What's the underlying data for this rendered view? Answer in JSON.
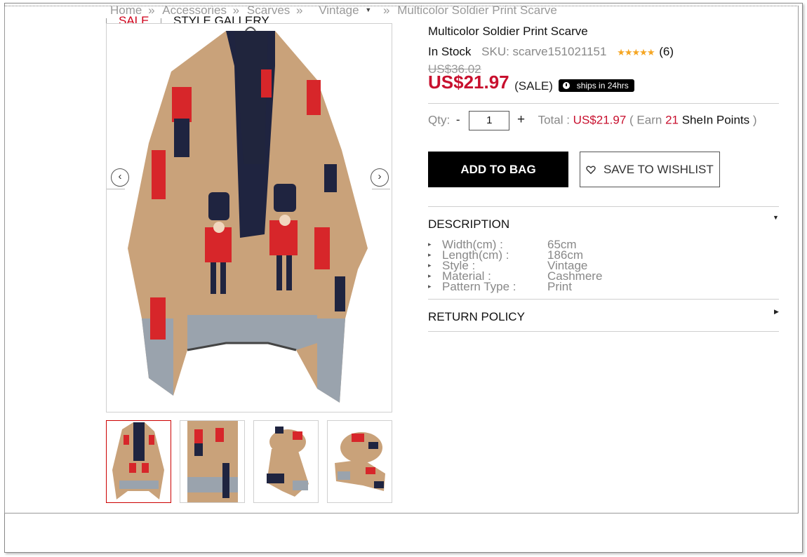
{
  "breadcrumb": {
    "home": "Home",
    "sep": "»",
    "accessories": "Accessories",
    "scarves": "Scarves",
    "vintage": "Vintage",
    "current": "Multicolor Soldier Print Scarve"
  },
  "gallery": {
    "tab_sale": "SALE",
    "tab_style": "STYLE GALLERY",
    "prev_arrow": "‹",
    "next_arrow": "›"
  },
  "product": {
    "title": "Multicolor Soldier Print Scarve",
    "stock": "In Stock",
    "sku": "SKU: scarve151021151",
    "rating_stars": "★★★★★",
    "review_count": "(6)",
    "original_price": "US$36.02",
    "sale_price": "US$21.97",
    "sale_tag": "(SALE)",
    "ship_badge": "ships in 24hrs"
  },
  "purchase": {
    "qty_label": "Qty:",
    "minus": "-",
    "qty_value": "1",
    "plus": "+",
    "total_label": "Total :",
    "total_value": "US$21.97",
    "earn_open": "( Earn",
    "points": "21",
    "shein_points": "SheIn Points",
    "earn_close": ")",
    "add_to_bag": "ADD TO BAG",
    "save_wishlist": "SAVE TO WISHLIST"
  },
  "description": {
    "title": "DESCRIPTION",
    "items": [
      {
        "key": "Width(cm) :",
        "value": "65cm"
      },
      {
        "key": "Length(cm) :",
        "value": "186cm"
      },
      {
        "key": "Style :",
        "value": "Vintage"
      },
      {
        "key": "Material :",
        "value": "Cashmere"
      },
      {
        "key": "Pattern Type :",
        "value": "Print"
      }
    ]
  },
  "return_policy": {
    "title": "RETURN POLICY"
  },
  "colors": {
    "sale_red": "#c8102e",
    "star_gold": "#f5a623",
    "scarf_tan": "#c9a27a",
    "soldier_red": "#d7262a",
    "navy": "#1f2440",
    "stripe_grey": "#9aa3ad"
  }
}
